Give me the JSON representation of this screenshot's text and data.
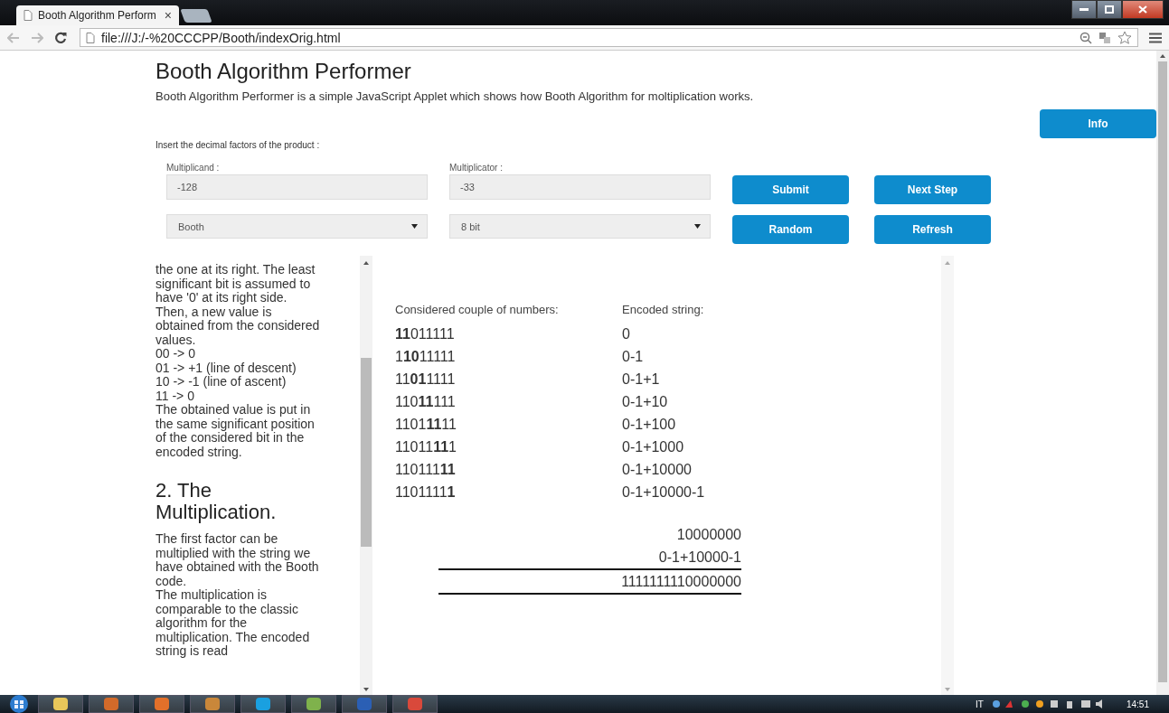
{
  "browser": {
    "tabs": [
      {
        "title": "Booth Algorithm Perform",
        "close": "×",
        "selected": true
      }
    ],
    "address": "file:///J:/-%20CCCPP/Booth/indexOrig.html"
  },
  "page": {
    "title": "Booth Algorithm Performer",
    "description": "Booth Algorithm Performer is a simple JavaScript Applet which shows how Booth Algorithm for moltiplication works.",
    "info_button": "Info",
    "instruction": "Insert the decimal factors of the product :",
    "fields": [
      {
        "label": "Multiplicand :",
        "value": "-128"
      },
      {
        "label": "Multiplicator :",
        "value": "-33"
      }
    ],
    "selects": [
      {
        "value": "Booth"
      },
      {
        "value": "8 bit"
      }
    ],
    "buttons": [
      [
        "Submit",
        "Next Step"
      ],
      [
        "Random",
        "Refresh"
      ]
    ],
    "guide": {
      "paragraphs": [
        "the one at its right. The least significant bit is assumed to have '0' at its right side.",
        "Then, a new value is obtained from the considered values.",
        "00 -> 0",
        "01 -> +1 (line of descent)",
        "10 -> -1 (line of ascent)",
        "11 -> 0",
        "The obtained value is put in the same significant position of the considered bit in the encoded string."
      ],
      "heading": "2. The Multiplication.",
      "paragraphs_2": [
        "The first factor can be multiplied with the string we have obtained with the Booth code.",
        "The multiplication is comparable to the classic algorithm for the multiplication. The encoded string is read"
      ]
    },
    "results": {
      "columns": [
        "Considered couple of numbers:",
        "Encoded string:"
      ],
      "rows": [
        {
          "bits": "**11**011111",
          "encoded": "0"
        },
        {
          "bits": "1**10**11111",
          "encoded": "0-1"
        },
        {
          "bits": "11**01**1111",
          "encoded": "0-1+1"
        },
        {
          "bits": "110**11**111",
          "encoded": "0-1+10"
        },
        {
          "bits": "1101**11**11",
          "encoded": "0-1+100"
        },
        {
          "bits": "11011**11**1",
          "encoded": "0-1+1000"
        },
        {
          "bits": "110111**11**",
          "encoded": "0-1+10000"
        },
        {
          "bits": "1101111**1**",
          "encoded": "0-1+10000-1"
        }
      ],
      "operation": {
        "operands": [
          "10000000",
          "0-1+10000-1"
        ],
        "product": "1111111110000000"
      }
    }
  },
  "taskbar": {
    "language": "IT",
    "clock": "14:51"
  }
}
